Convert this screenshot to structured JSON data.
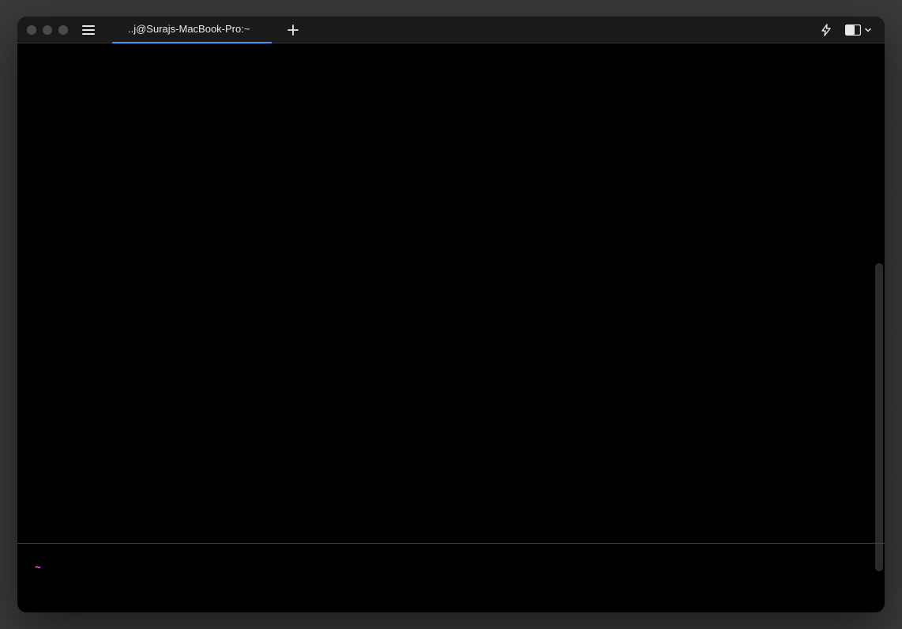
{
  "titlebar": {
    "tab_title": "..j@Surajs-MacBook-Pro:~"
  },
  "terminal": {
    "prompt_symbol": "~"
  }
}
